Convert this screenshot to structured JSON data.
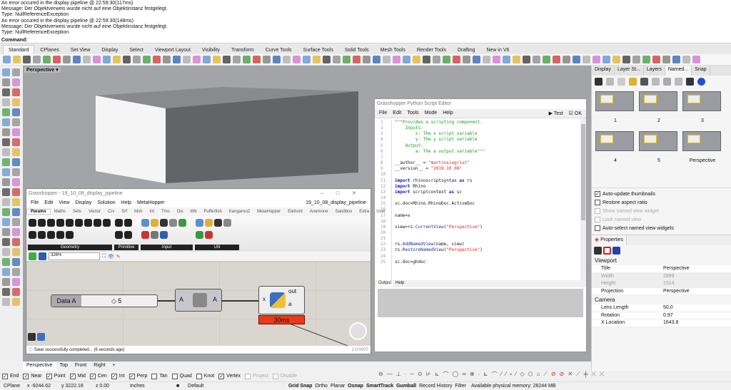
{
  "history": [
    "An error occured in the display pipeline @ 22:59:30(117ms)",
    "Message: Der Objektverweis wurde nicht auf eine Objektinstanz festgelegt.",
    "Type: NullReferenceException",
    "An error occured in the display pipeline @ 22:59:30(148ms)",
    "Message: Der Objektverweis wurde nicht auf eine Objektinstanz festgelegt.",
    "Type: NullReferenceException"
  ],
  "command_label": "Command:",
  "toolbar_tabs": [
    "Standard",
    "CPlanes",
    "Set View",
    "Display",
    "Select",
    "Viewport Layout",
    "Visibility",
    "Transform",
    "Curve Tools",
    "Surface Tools",
    "Solid Tools",
    "Mesh Tools",
    "Render Tools",
    "Drafting",
    "New in V6"
  ],
  "viewport": {
    "label": "Perspective ▾",
    "tabs": [
      "Perspective",
      "Top",
      "Front",
      "Right",
      "+"
    ]
  },
  "right_panel": {
    "tabs": [
      "Display",
      "Layer St...",
      "Layers",
      "Named...",
      "Snap"
    ],
    "thumbs": [
      "1",
      "2",
      "3",
      "4",
      "5",
      "Perspective"
    ],
    "options": [
      {
        "label": "Auto-update thumbnails",
        "checked": true,
        "disabled": false
      },
      {
        "label": "Restore aspect ratio",
        "checked": false,
        "disabled": false
      },
      {
        "label": "Show named view widget",
        "checked": false,
        "disabled": true
      },
      {
        "label": "Lock named view",
        "checked": false,
        "disabled": true
      },
      {
        "label": "Auto-select named view widgets",
        "checked": false,
        "disabled": false
      }
    ],
    "properties_tab": "Properties",
    "viewport_section": "Viewport",
    "viewport_rows": [
      [
        "Title",
        "Perspective"
      ],
      [
        "Width",
        "2899"
      ],
      [
        "Height",
        "1514"
      ],
      [
        "Projection",
        "Perspective"
      ]
    ],
    "camera_section": "Camera",
    "camera_rows": [
      [
        "Lens Length",
        "50.0"
      ],
      [
        "Rotation",
        "0.97"
      ],
      [
        "X Location",
        "1643.8"
      ]
    ]
  },
  "python_editor": {
    "title": "Grasshopper Python Script Editor",
    "menu": [
      "File",
      "Edit",
      "Tools",
      "Mode",
      "Help"
    ],
    "test": "Test",
    "ok": "OK",
    "output_tabs": [
      "Output",
      "Help"
    ]
  },
  "grasshopper": {
    "title": "Grasshopper - 19_10_08_display_pipeline",
    "menu": [
      "File",
      "Edit",
      "View",
      "Display",
      "Solution",
      "Help",
      "MetaHopper"
    ],
    "doc_name": "19_10_08_display_pipeline",
    "tabs": [
      "Params",
      "Maths",
      "Sets",
      "Vector",
      "Crv",
      "Srf",
      "Msh",
      "Int",
      "Trns",
      "Dis",
      "Wb",
      "Pufferfish",
      "Kangaroo2",
      "MetaHopper",
      "Elefront",
      "Anemone",
      "Sandbox",
      "Extra",
      "User"
    ],
    "groups": [
      "Geometry",
      "Primitive",
      "Input",
      "Util"
    ],
    "zoom": "326%",
    "slider_label": "Data A",
    "slider_value": "5",
    "relay_in": "A",
    "relay_out": "A",
    "py_in": "x",
    "py_out": [
      "out",
      "a"
    ],
    "py_time": "30ms",
    "status": "Save successfully completed... (6 seconds ago)",
    "version": "1.0.0007"
  },
  "osnaps": [
    {
      "label": "End",
      "checked": true
    },
    {
      "label": "Near",
      "checked": true
    },
    {
      "label": "Point",
      "checked": true
    },
    {
      "label": "Mid",
      "checked": true
    },
    {
      "label": "Cen",
      "checked": true
    },
    {
      "label": "Int",
      "checked": true
    },
    {
      "label": "Perp",
      "checked": true
    },
    {
      "label": "Tan",
      "checked": false
    },
    {
      "label": "Quad",
      "checked": false
    },
    {
      "label": "Knot",
      "checked": false
    },
    {
      "label": "Vertex",
      "checked": true
    },
    {
      "label": "Project",
      "checked": false
    },
    {
      "label": "Disable",
      "checked": false
    }
  ],
  "status": {
    "cplane": "CPlane",
    "x": "x -9244.62",
    "y": "y 3222.18",
    "z": "z 0.00",
    "units": "Inches",
    "layer": "Default",
    "toggles": [
      "Grid Snap",
      "Ortho",
      "Planar",
      "Osnap",
      "SmartTrack",
      "Gumball",
      "Record History",
      "Filter"
    ],
    "memory": "Available physical memory: 26244 MB"
  }
}
